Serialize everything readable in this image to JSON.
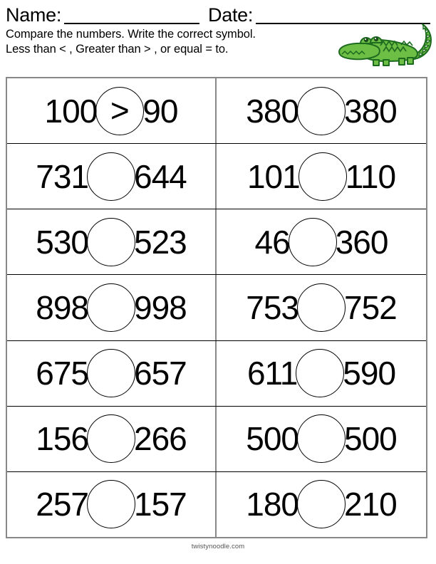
{
  "header": {
    "name_label": "Name:",
    "date_label": "Date:",
    "instruction_line_1": "Compare the numbers. Write the correct symbol.",
    "instruction_line_2": "Less than < , Greater than > , or equal  = to."
  },
  "decoration": {
    "alligator_icon": "alligator-icon",
    "body_color": "#6cbe45",
    "belly_color": "#8ccf5e",
    "outline_color": "#1d6b1f",
    "spike_color": "#f2f2ef",
    "eye_color": "#1b4d1e"
  },
  "worksheet": {
    "problems": [
      {
        "left": "100",
        "symbol": ">",
        "right": "90",
        "answered": true
      },
      {
        "left": "380",
        "symbol": "",
        "right": "380",
        "answered": false
      },
      {
        "left": "731",
        "symbol": "",
        "right": "644",
        "answered": false
      },
      {
        "left": "101",
        "symbol": "",
        "right": "110",
        "answered": false
      },
      {
        "left": "530",
        "symbol": "",
        "right": "523",
        "answered": false
      },
      {
        "left": "46",
        "symbol": "",
        "right": "360",
        "answered": false
      },
      {
        "left": "898",
        "symbol": "",
        "right": "998",
        "answered": false
      },
      {
        "left": "753",
        "symbol": "",
        "right": "752",
        "answered": false
      },
      {
        "left": "675",
        "symbol": "",
        "right": "657",
        "answered": false
      },
      {
        "left": "611",
        "symbol": "",
        "right": "590",
        "answered": false
      },
      {
        "left": "156",
        "symbol": "",
        "right": "266",
        "answered": false
      },
      {
        "left": "500",
        "symbol": "",
        "right": "500",
        "answered": false
      },
      {
        "left": "257",
        "symbol": "",
        "right": "157",
        "answered": false
      },
      {
        "left": "180",
        "symbol": "",
        "right": "210",
        "answered": false
      }
    ]
  },
  "footer": {
    "site": "twistynoodle.com"
  }
}
